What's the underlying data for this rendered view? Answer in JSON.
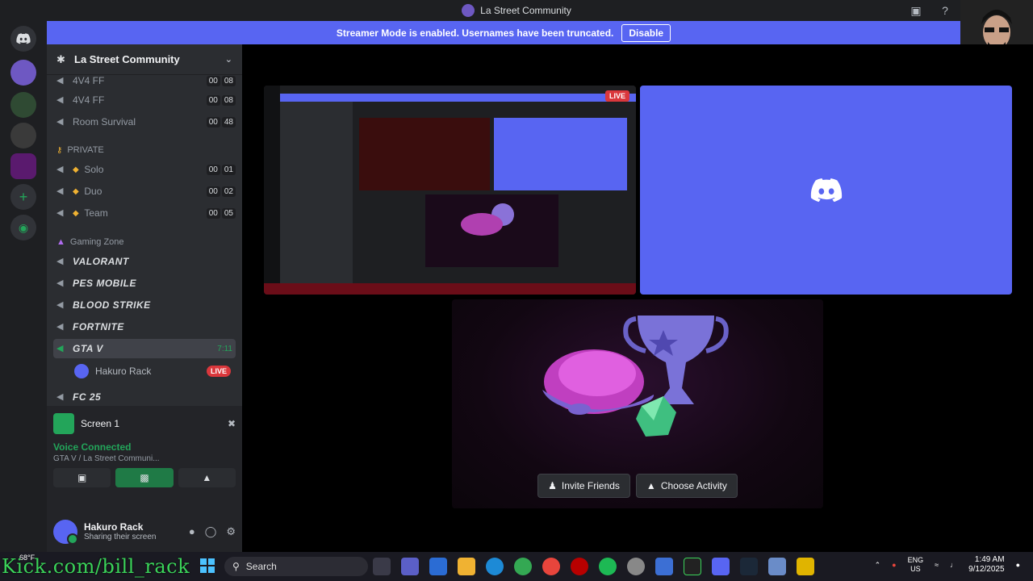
{
  "window": {
    "title": "La Street Community"
  },
  "streamer_banner": {
    "text": "Streamer Mode is enabled. Usernames have been truncated.",
    "button": "Disable"
  },
  "server": {
    "name": "La Street Community"
  },
  "channels_top": [
    {
      "name": "4V4 FF",
      "a": "00",
      "b": "08"
    },
    {
      "name": "4V4 FF",
      "a": "00",
      "b": "08"
    },
    {
      "name": "Room Survival",
      "a": "00",
      "b": "48"
    }
  ],
  "private_category": "PRIVATE",
  "private_channels": [
    {
      "name": "Solo",
      "a": "00",
      "b": "01"
    },
    {
      "name": "Duo",
      "a": "00",
      "b": "02"
    },
    {
      "name": "Team",
      "a": "00",
      "b": "05"
    }
  ],
  "gaming_category": "Gaming Zone",
  "gaming_channels": [
    {
      "name": "VALORANT"
    },
    {
      "name": "PES MOBILE"
    },
    {
      "name": "BLOOD STRIKE"
    },
    {
      "name": "FORTNITE"
    },
    {
      "name": "GTA V",
      "timer": "7:11"
    },
    {
      "name": "FC 25"
    }
  ],
  "voice_user": {
    "name": "Hakuro Rack",
    "badge": "LIVE"
  },
  "screen_panel": {
    "title": "Screen 1"
  },
  "voice_status": {
    "title": "Voice Connected",
    "subtitle": "GTA V / La Street Communi..."
  },
  "user_panel": {
    "name": "Hakuro Rack",
    "status": "Sharing their screen"
  },
  "stage": {
    "live_badge": "LIVE",
    "invite_label": "Invite Friends",
    "activity_label": "Choose Activity"
  },
  "taskbar": {
    "weather_temp": "68°F",
    "search_label": "Search",
    "lang_top": "ENG",
    "lang_bottom": "US",
    "time": "1:49 AM",
    "date": "9/12/2025"
  },
  "watermark": "Kick.com/bill_rack",
  "colors": {
    "blurple": "#5865f2",
    "green": "#23a55a",
    "red": "#da373c"
  }
}
